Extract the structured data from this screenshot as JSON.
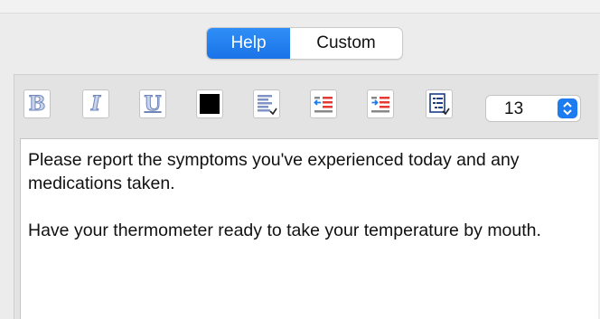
{
  "tabs": [
    {
      "label": "Help",
      "active": true
    },
    {
      "label": "Custom",
      "active": false
    }
  ],
  "toolbar": {
    "bold_letter": "B",
    "italic_letter": "I",
    "underline_letter": "U",
    "text_color": "#000000",
    "icons": [
      "bold-icon",
      "italic-icon",
      "underline-icon",
      "text-color-swatch",
      "align-menu-icon",
      "outdent-icon",
      "indent-icon",
      "list-menu-icon"
    ],
    "font_size": "13"
  },
  "text": {
    "paragraph_1": "Please report the symptoms you've experienced today and any medications taken.",
    "paragraph_2": "Have your thermometer ready to take your temperature by mouth."
  },
  "colors": {
    "accent": "#1a73e8",
    "icon_blue": "#1c7cf0",
    "icon_red": "#e53935"
  }
}
